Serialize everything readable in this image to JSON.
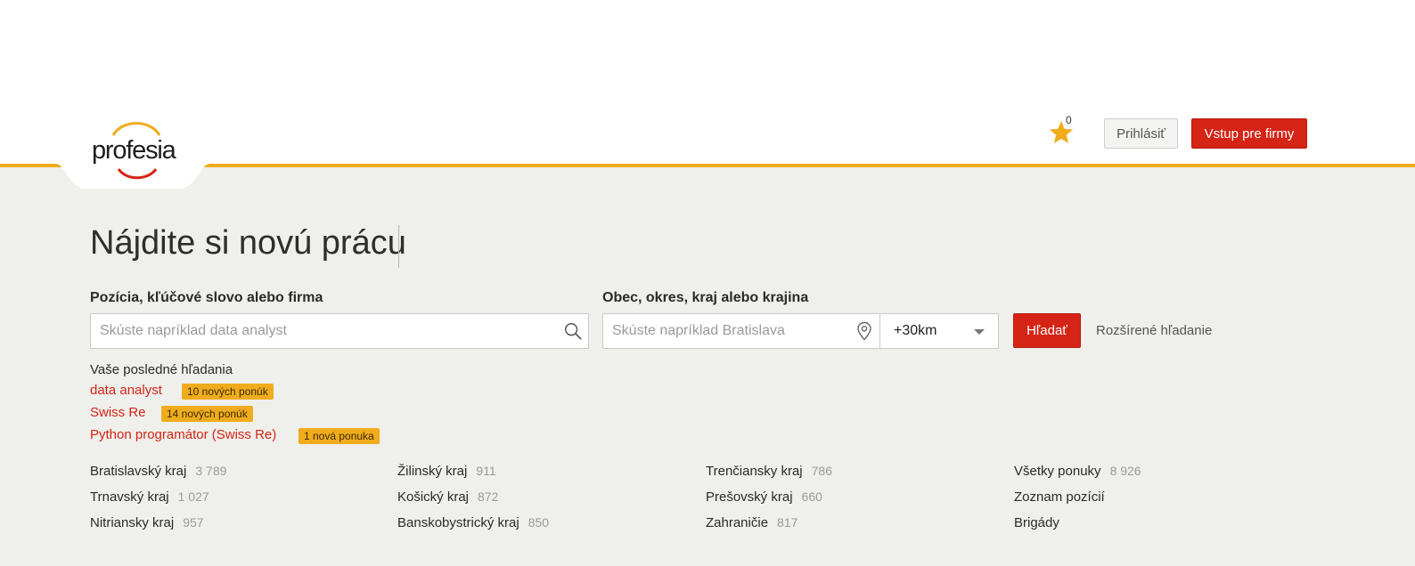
{
  "header": {
    "logo_text": "profesia",
    "favorites_count": "0",
    "login_label": "Prihlásiť",
    "firms_label": "Vstup pre firmy"
  },
  "main": {
    "title": "Nájdite si novú prácu",
    "position_label": "Pozícia, kľúčové slovo alebo firma",
    "position_placeholder": "Skúste napríklad data analyst",
    "location_label": "Obec, okres, kraj alebo krajina",
    "location_placeholder": "Skúste napríklad Bratislava",
    "radius_value": "+30km",
    "search_label": "Hľadať",
    "advanced_label": "Rozšírené hľadanie"
  },
  "recent": {
    "title": "Vaše posledné hľadania",
    "items": [
      {
        "label": "data analyst",
        "badge": "10 nových ponúk"
      },
      {
        "label": "Swiss Re",
        "badge": "14 nových ponúk"
      },
      {
        "label": "Python programátor (Swiss Re)",
        "badge": "1 nová ponuka"
      }
    ]
  },
  "regions": [
    {
      "name": "Bratislavský kraj",
      "count": "3 789"
    },
    {
      "name": "Trnavský kraj",
      "count": "1 027"
    },
    {
      "name": "Nitriansky kraj",
      "count": "957"
    },
    {
      "name": "Žilinský kraj",
      "count": "911"
    },
    {
      "name": "Košický kraj",
      "count": "872"
    },
    {
      "name": "Banskobystrický kraj",
      "count": "850"
    },
    {
      "name": "Trenčiansky kraj",
      "count": "786"
    },
    {
      "name": "Prešovský kraj",
      "count": "660"
    },
    {
      "name": "Zahraničie",
      "count": "817"
    },
    {
      "name": "Všetky ponuky",
      "count": "8 926"
    },
    {
      "name": "Zoznam pozícií",
      "count": ""
    },
    {
      "name": "Brigády",
      "count": ""
    }
  ],
  "colors": {
    "accent": "#f0ac1c",
    "brand_red": "#d52416",
    "background": "#efefeb"
  }
}
